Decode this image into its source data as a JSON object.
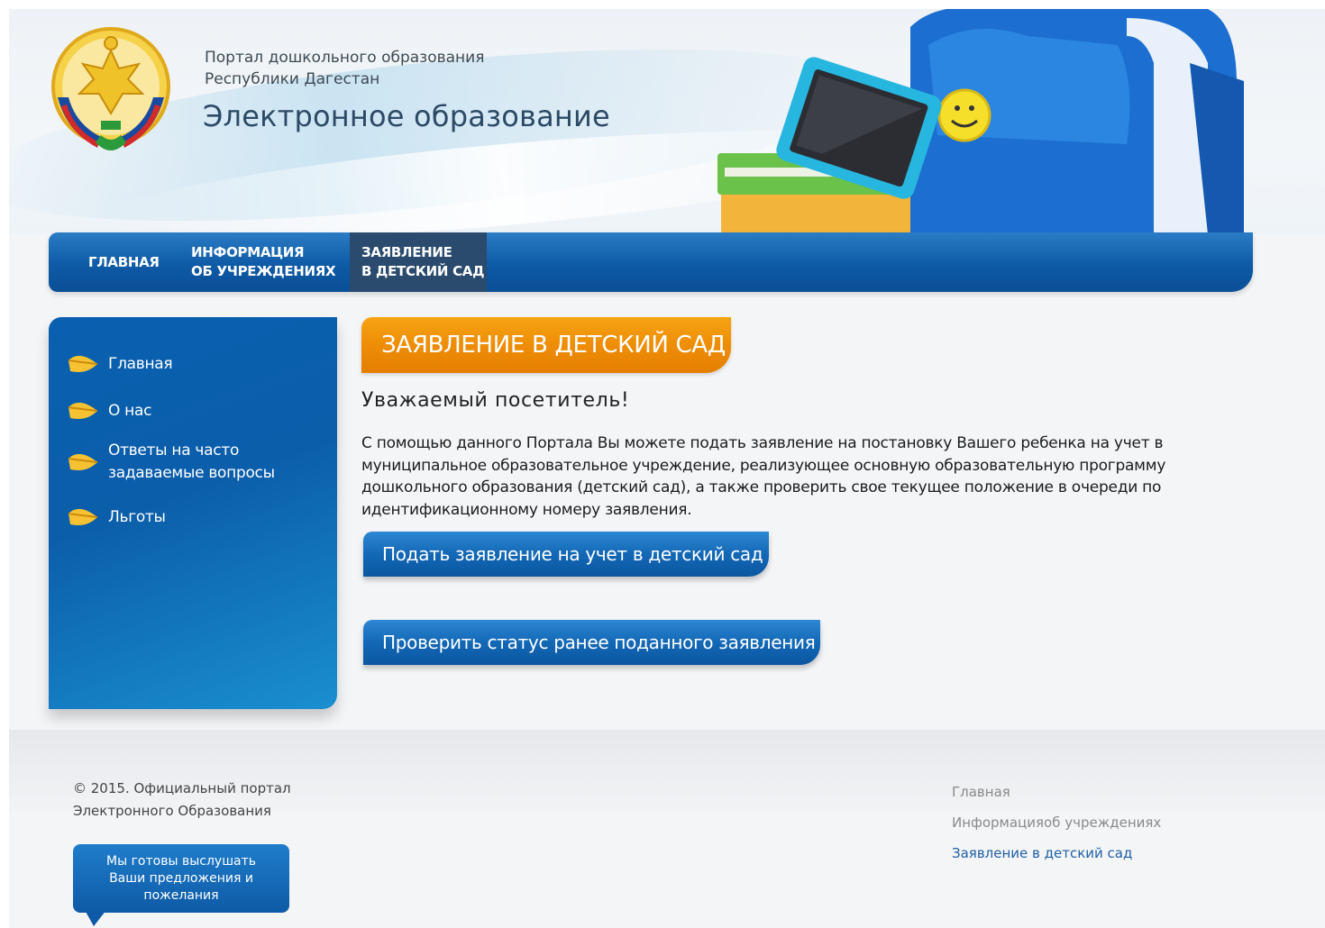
{
  "header": {
    "portal_line1": "Портал дошкольного образования",
    "portal_line2": "Республики Дагестан",
    "title": "Электронное образование"
  },
  "nav": {
    "home": "ГЛАВНАЯ",
    "info_line1": "ИНФОРМАЦИЯ",
    "info_line2": "ОБ УЧРЕЖДЕНИЯХ",
    "apply_line1": "ЗАЯВЛЕНИЕ",
    "apply_line2": "В ДЕТСКИЙ САД",
    "active": "apply"
  },
  "sidebar": {
    "items": [
      {
        "label": "Главная",
        "icon": "leaf-icon"
      },
      {
        "label": "О нас",
        "icon": "leaf-icon"
      },
      {
        "label_line1": "Ответы на часто",
        "label_line2": "задаваемые вопросы",
        "icon": "leaf-icon"
      },
      {
        "label": "Льготы",
        "icon": "leaf-icon"
      }
    ]
  },
  "main": {
    "section_title": "ЗАЯВЛЕНИЕ В ДЕТСКИЙ САД",
    "greeting": "Уважаемый посетитель!",
    "intro": "С помощью данного Портала Вы можете подать заявление на постановку Вашего ребенка на учет в муниципальное образовательное учреждение, реализующее основную образовательную программу дошкольного образования (детский сад), а также проверить свое текущее положение в очереди по идентификационному номеру заявления.",
    "apply_button": "Подать заявление на учет в детский сад",
    "check_button": "Проверить статус ранее поданного заявления"
  },
  "footer": {
    "copyright_line1": "© 2015. Официальный портал",
    "copyright_line2": "Электронного Образования",
    "feedback": "Мы готовы выслушать Ваши предложения и пожелания",
    "links": [
      "Главная",
      "Информацияоб учреждениях",
      "Заявление в детский сад"
    ]
  },
  "colors": {
    "nav_blue": "#0e5aa6",
    "nav_active": "#2a4b6d",
    "banner_orange": "#ee8d06",
    "text_dark": "#1c1c1c",
    "link_active": "#1f5fa6"
  }
}
